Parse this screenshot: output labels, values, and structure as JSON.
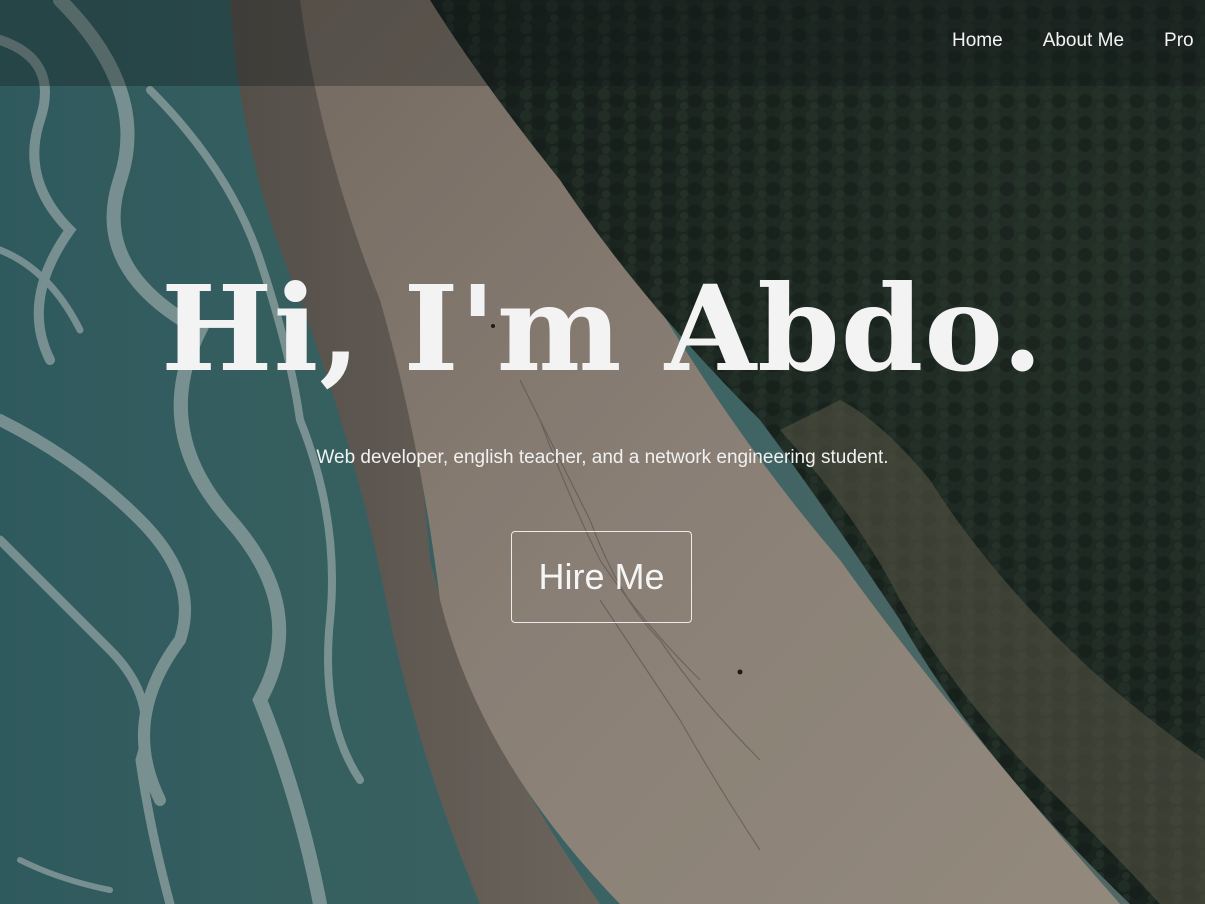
{
  "nav": {
    "items": [
      {
        "label": "Home"
      },
      {
        "label": "About Me"
      },
      {
        "label": "Pro"
      }
    ]
  },
  "hero": {
    "title": "Hi, I'm Abdo.",
    "subtitle": "Web developer, english teacher, and a network engineering student.",
    "cta_label": "Hire Me"
  },
  "colors": {
    "text": "#f3f3f3",
    "sea": "#3f6f6e",
    "sand": "#a69a8e",
    "forest": "#223028"
  }
}
